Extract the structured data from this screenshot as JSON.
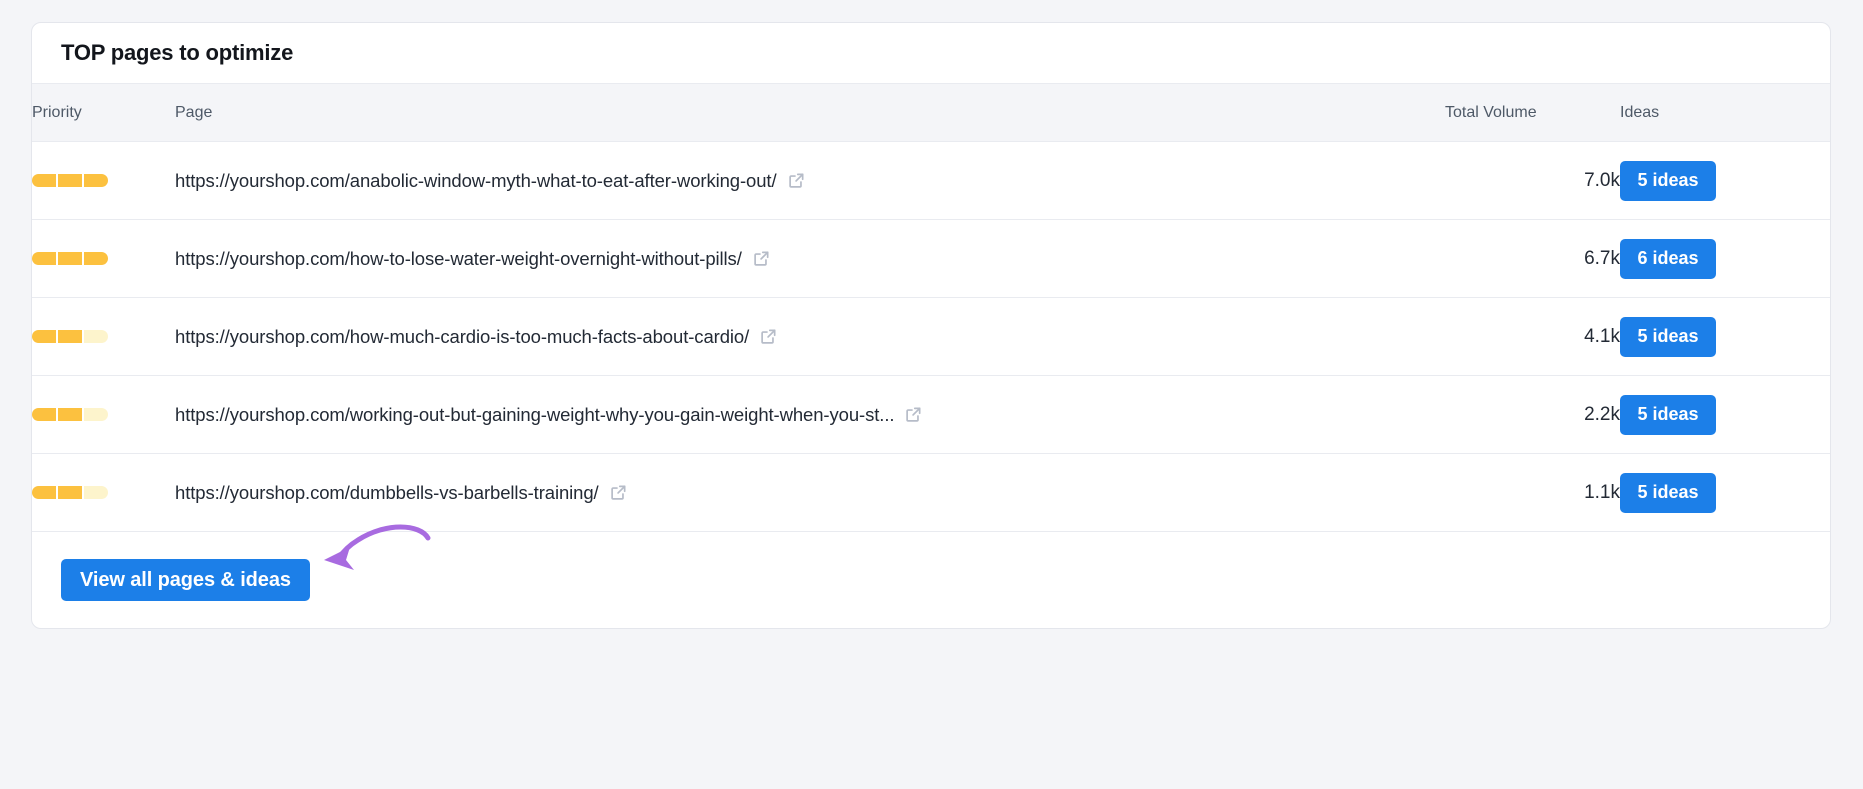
{
  "card": {
    "title": "TOP pages to optimize",
    "columns": {
      "priority": "Priority",
      "page": "Page",
      "volume": "Total Volume",
      "ideas": "Ideas"
    },
    "rows": [
      {
        "priority_filled": 3,
        "priority_total": 3,
        "url": "https://yourshop.com/anabolic-window-myth-what-to-eat-after-working-out/",
        "volume": "7.0k",
        "ideas": "5 ideas"
      },
      {
        "priority_filled": 3,
        "priority_total": 3,
        "url": "https://yourshop.com/how-to-lose-water-weight-overnight-without-pills/",
        "volume": "6.7k",
        "ideas": "6 ideas"
      },
      {
        "priority_filled": 2,
        "priority_total": 3,
        "url": "https://yourshop.com/how-much-cardio-is-too-much-facts-about-cardio/",
        "volume": "4.1k",
        "ideas": "5 ideas"
      },
      {
        "priority_filled": 2,
        "priority_total": 3,
        "url": "https://yourshop.com/working-out-but-gaining-weight-why-you-gain-weight-when-you-st...",
        "volume": "2.2k",
        "ideas": "5 ideas"
      },
      {
        "priority_filled": 2,
        "priority_total": 3,
        "url": "https://yourshop.com/dumbbells-vs-barbells-training/",
        "volume": "1.1k",
        "ideas": "5 ideas"
      }
    ],
    "footer": {
      "cta_label": "View all pages & ideas"
    }
  },
  "icons": {
    "external_link": "external-link-icon",
    "annotation": "annotation-arrow-icon"
  },
  "colors": {
    "accent_blue": "#1c7fe8",
    "priority_filled": "#fcc13f",
    "priority_empty": "#fdf4cc",
    "annotation_purple": "#a86be0",
    "header_row": "#f4f5f8",
    "page_background": "#f4f5f8"
  }
}
